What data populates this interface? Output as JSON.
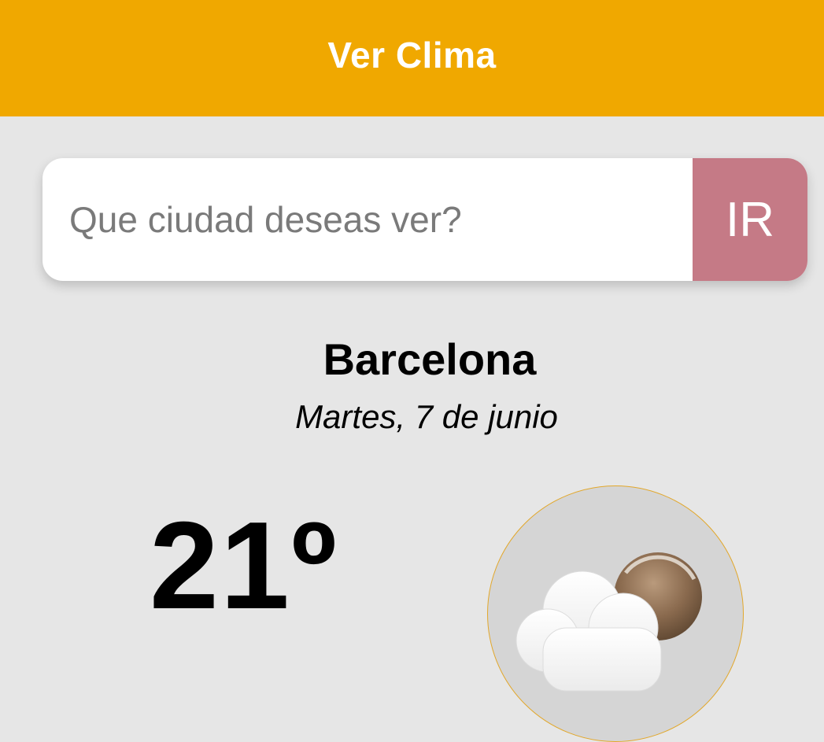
{
  "app_bar": {
    "title": "Ver Clima",
    "color": "#f0a800"
  },
  "search": {
    "placeholder": "Que ciudad deseas ver?",
    "value": "",
    "button_label": "IR",
    "button_color": "#c57a86"
  },
  "weather": {
    "city": "Barcelona",
    "date": "Martes, 7 de junio",
    "temperature": "21º",
    "icon": "partly-cloudy-night-icon"
  }
}
